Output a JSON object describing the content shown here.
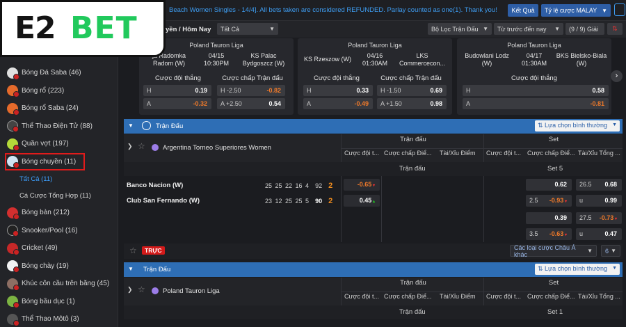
{
  "logo": {
    "part1": "E2",
    "part2": "BET"
  },
  "topbar": {
    "marquee": "Beach Women Singles - 14/4]. All bets taken are considered REFUNDED. Parlay counted as one(1). Thank you!",
    "result_btn": "Kết Quả",
    "odds_type": "Tỷ lệ cược MALAY"
  },
  "filter": {
    "period": "yền / Hôm Nay",
    "all": "Tất Cả",
    "league_filter": "Bộ Lọc Trận Đấu",
    "sort": "Từ trước đến nay",
    "prize_count": "(9 / 9) Giải"
  },
  "sidebar": {
    "items": [
      {
        "label": "Bóng Đá Saba (46)",
        "color": "#e0e0e0"
      },
      {
        "label": "Bóng rổ (223)",
        "color": "#e56a2b"
      },
      {
        "label": "Bóng rổ Saba (24)",
        "color": "#e56a2b"
      },
      {
        "label": "Thể Thao Điện Tử (88)",
        "color": "#444"
      },
      {
        "label": "Quần vợt (197)",
        "color": "#b5d93a"
      },
      {
        "label": "Bóng chuyền (11)",
        "color": "#cfe3f3"
      }
    ],
    "subitems": [
      {
        "label": "Tất Cả (11)"
      },
      {
        "label": "Cá Cược Tổng Hợp (11)"
      }
    ],
    "items2": [
      {
        "label": "Bóng bàn (212)",
        "color": "#d32f2f"
      },
      {
        "label": "Snooker/Pool (16)",
        "color": "#222"
      },
      {
        "label": "Cricket (49)",
        "color": "#c62828"
      },
      {
        "label": "Bóng chày (19)",
        "color": "#f2f2f2"
      },
      {
        "label": "Khúc côn cầu trên băng (45)",
        "color": "#8d6e63"
      },
      {
        "label": "Bóng bầu dục (1)",
        "color": "#7cb342"
      },
      {
        "label": "Thể Thao Môtô (3)",
        "color": "#555"
      }
    ]
  },
  "cards": [
    {
      "league": "Poland Tauron Liga",
      "home": "ja Radomka Radom (W)",
      "date": "04/15",
      "time": "10:30PM",
      "away": "KS Palac Bydgoszcz (W)",
      "lbl1": "Cược đội thắng",
      "lbl2": "Cược chấp Trận đấu",
      "h_win": "0.19",
      "a_win": "-0.32",
      "h_hcp": "-2.50",
      "h_hcp_odd": "-0.82",
      "a_hcp": "+2.50",
      "a_hcp_odd": "0.54"
    },
    {
      "league": "Poland Tauron Liga",
      "home": "KS Rzeszow (W)",
      "date": "04/16",
      "time": "01:30AM",
      "away": "LKS Commercecon...",
      "lbl1": "Cược đội thắng",
      "lbl2": "Cược chấp Trận đấu",
      "h_win": "0.33",
      "a_win": "-0.49",
      "h_hcp": "-1.50",
      "h_hcp_odd": "0.69",
      "a_hcp": "+1.50",
      "a_hcp_odd": "0.98"
    },
    {
      "league": "Poland Tauron Liga",
      "home": "Budowlani Lodz (W)",
      "date": "04/17",
      "time": "01:30AM",
      "away": "BKS Bielsko-Biala (W)",
      "lbl1": "Cược đội thắng",
      "h_win": "0.58",
      "a_win": "-0.81"
    }
  ],
  "section1": {
    "title": "Trận Đấu",
    "view_select": "Lựa chọn bình thường",
    "league": "Argentina Torneo Superiores Women",
    "grp1": "Trận đấu",
    "grp2": "Set",
    "cols": [
      "Cược đội t...",
      "Cược chấp Điể...",
      "Tài/Xỉu Điểm",
      "Cược đội t...",
      "Cược chấp Điể...",
      "Tài/Xỉu Tổng ..."
    ],
    "period_left": "Trận đấu",
    "period_right": "Set 5",
    "team1": "Banco Nacion (W)",
    "team1_sets": "25 25 22 16 4",
    "team1_pts": "92",
    "team1_cur": "2",
    "team2": "Club San Fernando (W)",
    "team2_sets": "23 12 25 25 5",
    "team2_pts": "90",
    "team2_cur": "2",
    "m_h": "-0.65",
    "m_a": "0.45",
    "s_h": "0.62",
    "s_a_k": "2.5",
    "s_a": "-0.93",
    "s_ou_k1": "26.5",
    "s_ou_v1": "0.68",
    "s_ou_k2": "u",
    "s_ou_v2": "0.99",
    "s2_h": "0.39",
    "s2_a_k": "3.5",
    "s2_a": "-0.63",
    "s2_ou_k1": "27.5",
    "s2_ou_v1": "-0.73",
    "s2_ou_k2": "u",
    "s2_ou_v2": "0.47",
    "live": "TRỰC",
    "more_bets": "Các loại cược Châu Á khác",
    "count": "6"
  },
  "section2": {
    "title": "Trận Đấu",
    "view_select": "Lựa chọn bình thường",
    "league": "Poland Tauron Liga",
    "grp1": "Trận đấu",
    "grp2": "Set",
    "cols": [
      "Cược đội t...",
      "Cược chấp Điể...",
      "Tài/Xỉu Điểm",
      "Cược đội t...",
      "Cược chấp Điể...",
      "Tài/Xỉu Tổng ..."
    ],
    "period_left": "Trận đấu",
    "period_right": "Set 1"
  }
}
